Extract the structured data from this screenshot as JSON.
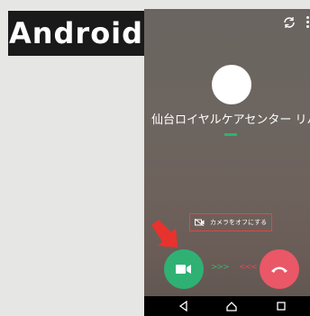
{
  "platform_label": "Android",
  "call": {
    "caller_name": "仙台ロイヤルケアセンター リハビリ",
    "camera_off_label": "カメラをオフにする"
  },
  "hints": {
    "accept": ">>>",
    "decline": "<<<"
  },
  "icons": {
    "rotate": "camera-switch-icon",
    "more": "more-vertical-icon",
    "camera_off": "video-off-icon",
    "accept": "video-call-icon",
    "decline": "hang-up-icon",
    "back": "back-triangle-icon",
    "home": "home-icon",
    "recents": "recents-square-icon",
    "pointer": "red-arrow-icon"
  },
  "colors": {
    "accept": "#2fb174",
    "decline": "#ea5766",
    "highlight": "#d94a4a"
  }
}
